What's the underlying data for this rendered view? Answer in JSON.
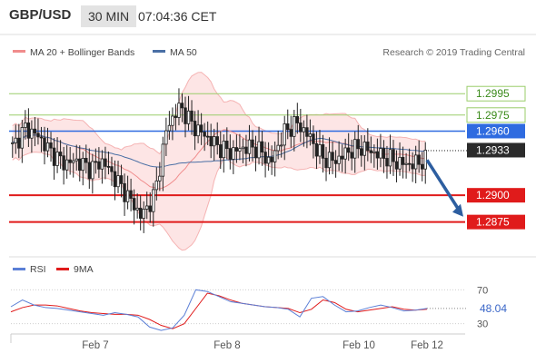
{
  "header": {
    "pair": "GBP/USD",
    "timeframe": "30 MIN",
    "time": "07:04:36 CET"
  },
  "legend": {
    "ma20": "MA 20 + Bollinger Bands",
    "ma50": "MA 50",
    "credit": "Research © 2019 Trading Central",
    "rsi": "RSI",
    "ma9": "9MA"
  },
  "colors": {
    "ma20": "#f08c8c",
    "ma50": "#4a6fa5",
    "bands": "#fde0e0",
    "resistance": "#9acd6a",
    "pivot": "#2f6be0",
    "support": "#e01b1b",
    "rsi": "#5b7fd6",
    "ma9": "#e01b1b",
    "arrow": "#2d5ea0"
  },
  "chart_data": {
    "type": "candlestick",
    "ylim": [
      1.2845,
      1.3013
    ],
    "levels": [
      {
        "value": 1.2995,
        "kind": "resistance",
        "label": "1.2995"
      },
      {
        "value": 1.2975,
        "kind": "resistance",
        "label": "1.2975"
      },
      {
        "value": 1.296,
        "kind": "pivot",
        "label": "1.2960"
      },
      {
        "value": 1.29,
        "kind": "support",
        "label": "1.2900"
      },
      {
        "value": 1.2875,
        "kind": "support",
        "label": "1.2875"
      }
    ],
    "last_price": "1.2933",
    "ma_value": "1.2940",
    "x_labels": [
      "Feb 7",
      "Feb 8",
      "Feb 10",
      "Feb 12"
    ],
    "key_points": [
      1.2945,
      1.2963,
      1.2955,
      1.294,
      1.293,
      1.2932,
      1.2925,
      1.2932,
      1.2915,
      1.2898,
      1.288,
      1.29,
      1.2965,
      1.2983,
      1.2965,
      1.2955,
      1.2945,
      1.294,
      1.2945,
      1.2944,
      1.293,
      1.2958,
      1.2968,
      1.2955,
      1.2935,
      1.2932,
      1.2941,
      1.2945,
      1.294,
      1.2935,
      1.293,
      1.2929,
      1.2933
    ],
    "projection": {
      "from": 1.2933,
      "to": 1.288
    },
    "rsi": {
      "name": "RSI",
      "ylim": [
        20,
        80
      ],
      "levels": [
        70,
        30
      ],
      "level_labels": [
        "70",
        "30"
      ],
      "last": "48.04",
      "values": [
        50,
        58,
        52,
        49,
        48,
        46,
        44,
        42,
        40,
        43,
        41,
        38,
        26,
        22,
        25,
        40,
        70,
        68,
        62,
        56,
        54,
        52,
        50,
        49,
        47,
        38,
        60,
        62,
        52,
        44,
        45,
        49,
        52,
        49,
        45,
        46,
        48
      ],
      "ma9": [
        44,
        49,
        52,
        52,
        51,
        48,
        45,
        43,
        42,
        41,
        41,
        40,
        35,
        28,
        24,
        30,
        48,
        66,
        63,
        58,
        54,
        52,
        50,
        49,
        48,
        43,
        47,
        58,
        55,
        47,
        44,
        46,
        48,
        50,
        47,
        46,
        47
      ]
    }
  }
}
